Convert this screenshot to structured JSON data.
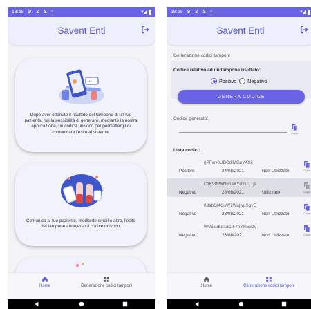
{
  "status": {
    "time": "18:59"
  },
  "app": {
    "title": "Savent Enti"
  },
  "home": {
    "card1_text": "Dopo aver ottenuto il risultato del tampone di un tuo paziente, hai la possibilità di generare, mediante la nostra applicazione, un codice univoco per permettergli di comunicare l'esito al sistema.",
    "card2_text": "Comunica al tuo paziente, mediante email o altro, l'esito del tampone attraverso il codice univoco."
  },
  "generator": {
    "section_title": "Generazione codici tamponi",
    "label": "Codice relativo ad un tampone risultato:",
    "options": [
      "Positivo",
      "Negativo"
    ],
    "selected": "Positivo",
    "button_label": "GENERA CODICE",
    "generated_label": "Codice generato:",
    "generated_value": "",
    "copy_label": "Copia"
  },
  "codes": {
    "title": "Lista codici:",
    "rows": [
      {
        "code": "rjPFwv0UDCdlMGnY4Xit",
        "result": "Positivo",
        "date": "24/08/2021",
        "status": "Non Utilizzato",
        "selected": false
      },
      {
        "code": "CzK9tNWN6haXYdYU1Tjs",
        "result": "Negativo",
        "date": "23/08/2021",
        "status": "Utilizzato",
        "selected": true
      },
      {
        "code": "0dabQi4OsW7WajwpSgvE",
        "result": "Negativo",
        "date": "23/08/2021",
        "status": "Non Utilizzato",
        "selected": false
      },
      {
        "code": "WV5xuBd3aClF7hYmEx2v",
        "result": "Negativo",
        "date": "23/08/2021",
        "status": "Non Utilizzato",
        "selected": false
      }
    ]
  },
  "nav": {
    "home_label": "Home",
    "gen_label": "Generazione codici tamponi"
  },
  "colors": {
    "accent": "#6a63e6",
    "title": "#5a56d6",
    "appbar": "#eeeffc",
    "nav_active_left": "#5a56d6",
    "nav_active_right": "#5a56d6"
  }
}
